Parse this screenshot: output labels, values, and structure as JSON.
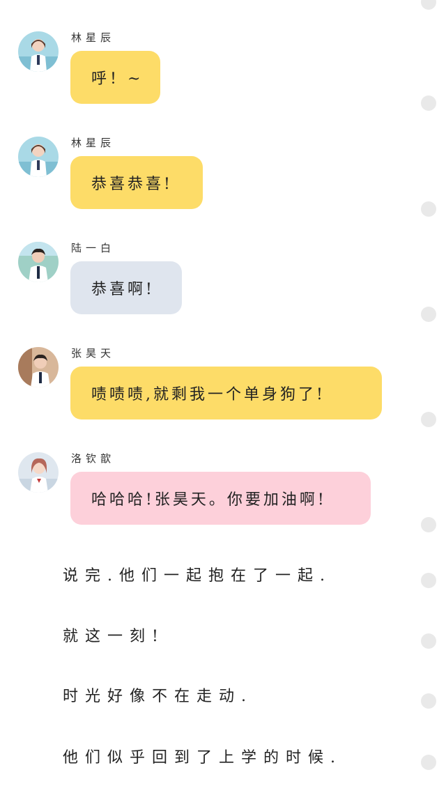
{
  "messages": [
    {
      "sender": "林星辰",
      "text": "呼！~",
      "bubble_color": "#fddc68",
      "avatar": "girl-avatar"
    },
    {
      "sender": "林星辰",
      "text": "恭喜恭喜!",
      "bubble_color": "#fddc68",
      "avatar": "girl-avatar"
    },
    {
      "sender": "陆一白",
      "text": "恭喜啊!",
      "bubble_color": "#dfe5ee",
      "avatar": "boy-avatar"
    },
    {
      "sender": "张昊天",
      "text": "啧啧啧,就剩我一个单身狗了!",
      "bubble_color": "#fddc68",
      "avatar": "boy-avatar"
    },
    {
      "sender": "洛钦歆",
      "text": "哈哈哈!张昊天。你要加油啊!",
      "bubble_color": "#fdd0da",
      "avatar": "girl-avatar"
    }
  ],
  "narration": [
    "说完.他们一起抱在了一起.",
    "就这一刻!",
    "时光好像不在走动.",
    "他们似乎回到了上学的时候."
  ]
}
